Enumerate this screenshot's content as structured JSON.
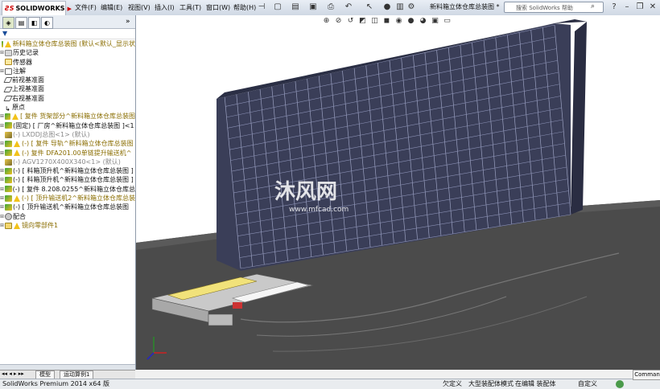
{
  "app": {
    "logo": "SOLIDWORKS",
    "document_title": "新料箱立体仓库总装图 *",
    "search_placeholder": "搜索 SolidWorks 帮助"
  },
  "menu": [
    {
      "label": "文件(F)"
    },
    {
      "label": "编辑(E)"
    },
    {
      "label": "视图(V)"
    },
    {
      "label": "插入(I)"
    },
    {
      "label": "工具(T)"
    },
    {
      "label": "窗口(W)"
    },
    {
      "label": "帮助(H)"
    }
  ],
  "panel": {
    "collapse_label": "»",
    "tree": [
      {
        "label": "新料箱立体仓库总装图 (默认<默认_显示状",
        "icon": "assembly-icon",
        "style": "y",
        "warn": true,
        "expander": false
      },
      {
        "label": "历史记录",
        "icon": "history-icon",
        "style": "",
        "warn": false,
        "expander": true
      },
      {
        "label": "传感器",
        "icon": "sensor-icon",
        "style": "",
        "warn": false,
        "expander": false
      },
      {
        "label": "注解",
        "icon": "annotation-icon",
        "style": "",
        "warn": false,
        "expander": true
      },
      {
        "label": "前视基准面",
        "icon": "plane-icon",
        "style": "",
        "warn": false,
        "expander": false
      },
      {
        "label": "上视基准面",
        "icon": "plane-icon",
        "style": "",
        "warn": false,
        "expander": false
      },
      {
        "label": "右视基准面",
        "icon": "plane-icon",
        "style": "",
        "warn": false,
        "expander": false
      },
      {
        "label": "原点",
        "icon": "origin-icon",
        "style": "",
        "warn": false,
        "expander": false
      },
      {
        "label": "[ 复件 货架部分^新料箱立体仓库总装图",
        "icon": "assembly-icon",
        "style": "y",
        "warn": true,
        "expander": true
      },
      {
        "label": "(固定) [ 厂房^新料箱立体仓库总装图 ]<1",
        "icon": "assembly-icon",
        "style": "",
        "warn": false,
        "expander": true
      },
      {
        "label": "(-) LXDDJ总图<1> (默认)",
        "icon": "part-icon",
        "style": "g",
        "warn": false,
        "expander": false
      },
      {
        "label": "(-) [ 复件 导轨^新料箱立体仓库总装图",
        "icon": "assembly-icon",
        "style": "y",
        "warn": true,
        "expander": true
      },
      {
        "label": "(-) 复件 DFA201.00单链提升输送机^",
        "icon": "assembly-icon",
        "style": "y",
        "warn": true,
        "expander": true
      },
      {
        "label": "(-) AGV1270X400X340<1> (默认)",
        "icon": "part-icon",
        "style": "g",
        "warn": false,
        "expander": false
      },
      {
        "label": "(-) [ 料箱顶升机^新料箱立体仓库总装图 ]",
        "icon": "assembly-icon",
        "style": "",
        "warn": false,
        "expander": true
      },
      {
        "label": "(-) [ 料箱顶升机^新料箱立体仓库总装图 ]",
        "icon": "assembly-icon",
        "style": "",
        "warn": false,
        "expander": true
      },
      {
        "label": "(-) [ 复件 8.208.0255^新料箱立体仓库总",
        "icon": "assembly-icon",
        "style": "",
        "warn": false,
        "expander": true
      },
      {
        "label": "(-) [ 顶升输送机2^新料箱立体仓库总装",
        "icon": "assembly-icon",
        "style": "y",
        "warn": true,
        "expander": true
      },
      {
        "label": "(-) [ 顶升输送机^新料箱立体仓库总装图",
        "icon": "assembly-icon",
        "style": "",
        "warn": false,
        "expander": true
      },
      {
        "label": "配合",
        "icon": "mates-icon",
        "style": "",
        "warn": false,
        "expander": true
      },
      {
        "label": "镜向零部件1",
        "icon": "mirror-icon",
        "style": "y",
        "warn": true,
        "expander": true
      }
    ]
  },
  "bottom_tabs": [
    {
      "label": "模型"
    },
    {
      "label": "运动算例1"
    }
  ],
  "status": {
    "app_version": "SolidWorks Premium 2014 x64 版",
    "s1": "欠定义",
    "s2": "大型装配体模式",
    "s3": "在编辑 装配体",
    "s4": "自定义",
    "command": "Comman"
  },
  "watermark": {
    "text": "沐风网",
    "url": "www.mfcad.com"
  },
  "colors": {
    "accent": "#1a4d99",
    "warning": "#f2c21b",
    "rack": "#2b2f45",
    "floor": "#4a4a4a"
  }
}
